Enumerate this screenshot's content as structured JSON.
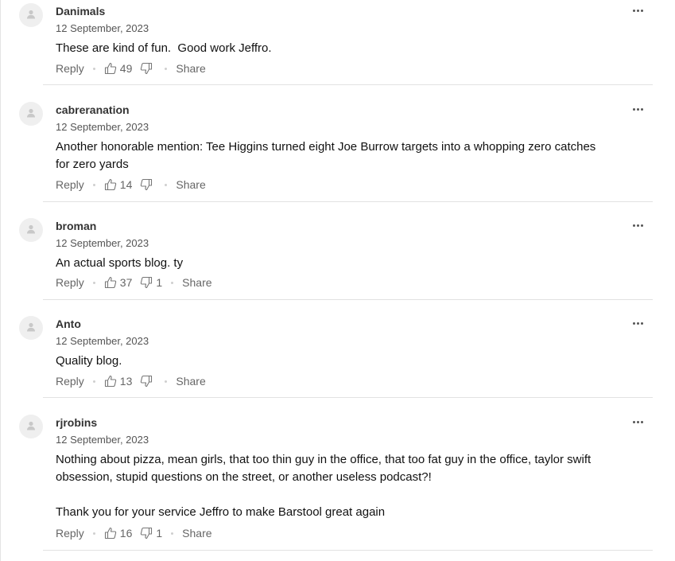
{
  "comments": [
    {
      "username": "Danimals",
      "date": "12 September, 2023",
      "text": "These are kind of fun.  Good work Jeffro.",
      "reply_label": "Reply",
      "likes": "49",
      "dislikes": "",
      "share_label": "Share"
    },
    {
      "username": "cabreranation",
      "date": "12 September, 2023",
      "text": "Another honorable mention: Tee Higgins turned eight Joe Burrow targets into a whopping zero catches for zero yards",
      "reply_label": "Reply",
      "likes": "14",
      "dislikes": "",
      "share_label": "Share"
    },
    {
      "username": "broman",
      "date": "12 September, 2023",
      "text": "An actual sports blog. ty",
      "reply_label": "Reply",
      "likes": "37",
      "dislikes": "1",
      "share_label": "Share"
    },
    {
      "username": "Anto",
      "date": "12 September, 2023",
      "text": "Quality blog.",
      "reply_label": "Reply",
      "likes": "13",
      "dislikes": "",
      "share_label": "Share"
    },
    {
      "username": "rjrobins",
      "date": "12 September, 2023",
      "text": "Nothing about pizza, mean girls, that too thin guy in the office, that too fat guy in the office, taylor swift obsession, stupid questions on the street, or another useless podcast?!\n\nThank you for your service Jeffro to make Barstool great again",
      "reply_label": "Reply",
      "likes": "16",
      "dislikes": "1",
      "share_label": "Share"
    }
  ],
  "icons": {
    "avatar": "user-avatar-icon",
    "more": "more-options-icon",
    "like": "thumbs-up-icon",
    "dislike": "thumbs-down-icon"
  }
}
